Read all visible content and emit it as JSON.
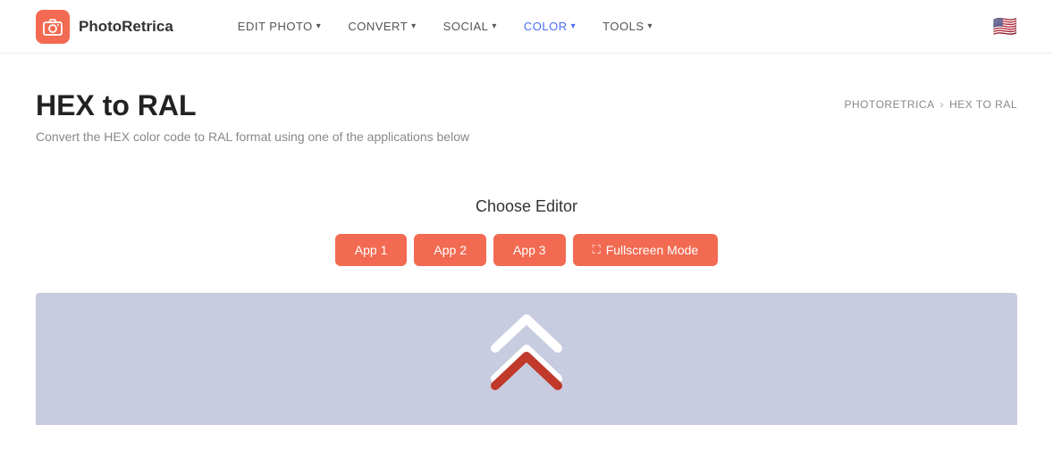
{
  "header": {
    "logo_text": "PhotoRetrica",
    "nav_items": [
      {
        "label": "EDIT PHOTO",
        "active": false
      },
      {
        "label": "CONVERT",
        "active": false
      },
      {
        "label": "SOCIAL",
        "active": false
      },
      {
        "label": "COLOR",
        "active": true
      },
      {
        "label": "TOOLS",
        "active": false
      }
    ],
    "flag_emoji": "🇺🇸"
  },
  "breadcrumb": {
    "home": "PHOTORETRICA",
    "separator": "›",
    "current": "HEX TO RAL"
  },
  "page": {
    "title": "HEX to RAL",
    "subtitle": "Convert the HEX color code to RAL format using one of the applications below"
  },
  "editor": {
    "title": "Choose Editor",
    "buttons": [
      {
        "label": "App 1"
      },
      {
        "label": "App 2"
      },
      {
        "label": "App 3"
      },
      {
        "label": "Fullscreen Mode",
        "fullscreen": true
      }
    ]
  },
  "colors": {
    "accent": "#f26a52",
    "active_nav": "#4a6cf7",
    "preview_bg": "#c8cce0"
  }
}
